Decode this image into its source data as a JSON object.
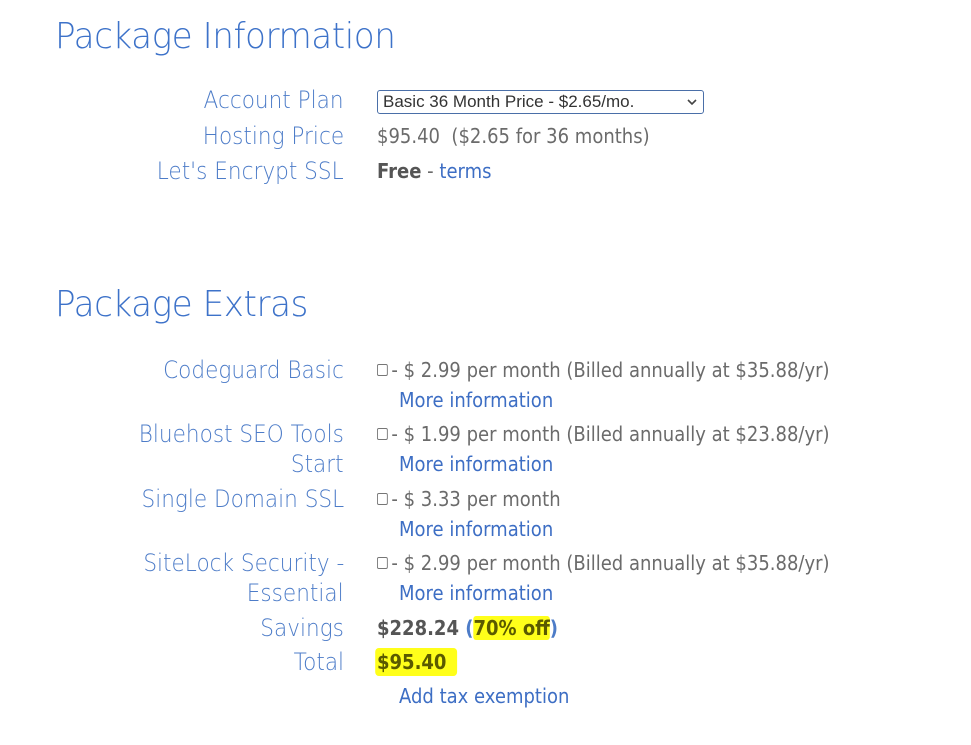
{
  "package_info": {
    "title": "Package Information",
    "account_plan": {
      "label": "Account Plan",
      "selected": "Basic 36 Month Price - $2.65/mo."
    },
    "hosting_price": {
      "label": "Hosting Price",
      "value": "$95.40  ($2.65 for 36 months)"
    },
    "ssl": {
      "label": "Let's Encrypt SSL",
      "value": "Free",
      "separator": " - ",
      "link": "terms"
    }
  },
  "package_extras": {
    "title": "Package Extras",
    "items": [
      {
        "label_line1": "Codeguard Basic",
        "label_line2": "",
        "checked": false,
        "price": "- $ 2.99 per month (Billed annually at $35.88/yr)",
        "more": "More information"
      },
      {
        "label_line1": "Bluehost SEO Tools",
        "label_line2": "Start",
        "checked": false,
        "price": "- $ 1.99 per month (Billed annually at $23.88/yr)",
        "more": "More information"
      },
      {
        "label_line1": "Single Domain SSL",
        "label_line2": "",
        "checked": false,
        "price": "- $ 3.33 per month",
        "more": "More information"
      },
      {
        "label_line1": "SiteLock Security -",
        "label_line2": "Essential",
        "checked": false,
        "price": "- $ 2.99 per month (Billed annually at $35.88/yr)",
        "more": "More information"
      }
    ],
    "savings": {
      "label": "Savings",
      "amount": "$228.24",
      "open_paren": " (",
      "discount": "70% off",
      "close_paren": ")"
    },
    "total": {
      "label": "Total",
      "amount": "$95.40"
    },
    "tax_link": "Add tax exemption"
  },
  "colors": {
    "heading": "#3d72c9",
    "label": "#4d7cc8",
    "link": "#3d6ec4",
    "text": "#6b6b6b",
    "highlight": "#ffff1a"
  }
}
